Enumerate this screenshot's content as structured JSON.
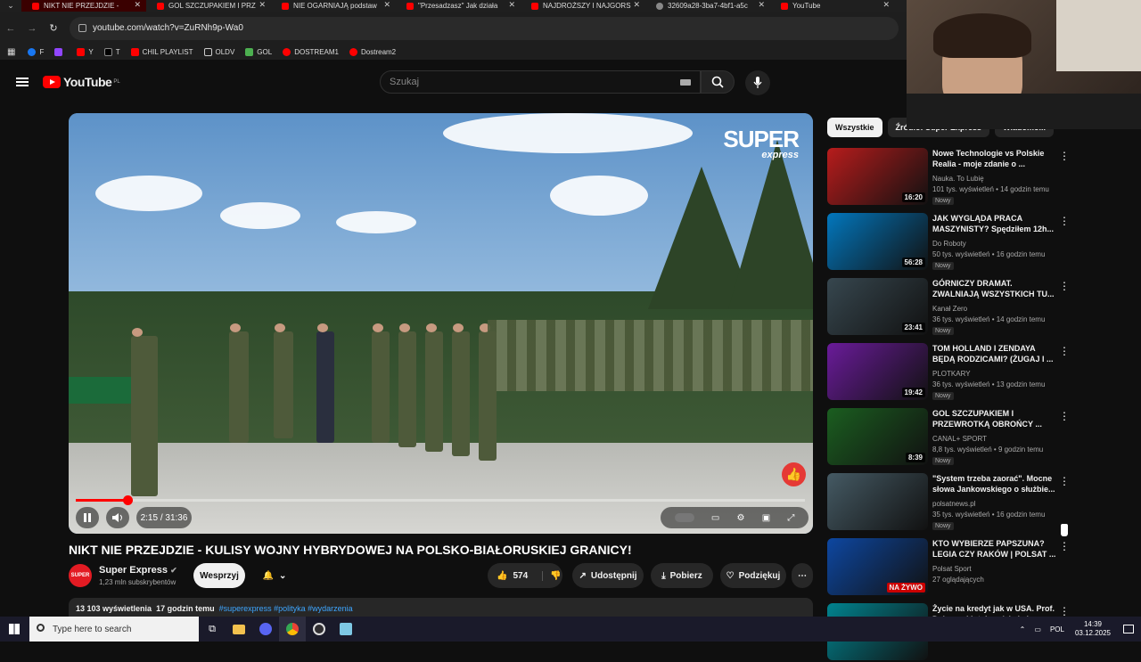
{
  "browser": {
    "tabs": [
      {
        "label": "NIKT NIE PRZEJDZIE -",
        "active": true
      },
      {
        "label": "GOL SZCZUPAKIEM I PRZ"
      },
      {
        "label": "NIE OGARNIAJĄ podstaw"
      },
      {
        "label": "\"Przesadzasz\" Jak działa"
      },
      {
        "label": "NAJDROŻSZY I NAJGORS"
      },
      {
        "label": "32609a28-3ba7-4bf1-a5c"
      },
      {
        "label": "YouTube"
      }
    ],
    "url": "youtube.com/watch?v=ZuRNh9p-Wa0",
    "bookmarks": [
      "F",
      "Y",
      "T",
      "CHIL PLAYLIST",
      "OLDV",
      "GOL",
      "DOSTREAM1",
      "Dostream2"
    ]
  },
  "header": {
    "logo": "YouTube",
    "region": "PL",
    "search_placeholder": "Szukaj"
  },
  "player": {
    "brand_line1": "SUPER",
    "brand_line2": "express",
    "time": "2:15 / 31:36",
    "progress": 0.071
  },
  "video": {
    "title": "NIKT NIE PRZEJDZIE - KULISY WOJNY HYBRYDOWEJ NA POLSKO-BIAŁORUSKIEJ GRANICY!",
    "channel": "Super Express",
    "channel_avatar": "SUPER",
    "subscribers": "1,23 mln subskrybentów",
    "support": "Wesprzyj",
    "likes": "574",
    "share": "Udostępnij",
    "download": "Pobierz",
    "thanks": "Podziękuj",
    "views": "13 103 wyświetlenia",
    "age": "17 godzin temu",
    "tags": "#superexpress #polityka #wydarzenia"
  },
  "chips": [
    "Wszystkie",
    "Źródło: Super Express",
    "Wiadomo..."
  ],
  "recommendations": [
    {
      "title": "Nowe Technologie vs Polskie Realia - moje zdanie o ...",
      "channel": "Nauka. To Lubię",
      "meta": "101 tys. wyświetleń • 14 godzin temu",
      "badge": "Nowy",
      "duration": "16:20",
      "color": "#b71c1c"
    },
    {
      "title": "JAK WYGLĄDA PRACA MASZYNISTY? Spędziłem 12h...",
      "channel": "Do Roboty",
      "meta": "50 tys. wyświetleń • 16 godzin temu",
      "badge": "Nowy",
      "duration": "56:28",
      "color": "#0277bd"
    },
    {
      "title": "GÓRNICZY DRAMAT. ZWALNIAJĄ WSZYSTKICH TU...",
      "channel": "Kanał Zero",
      "meta": "36 tys. wyświetleń • 14 godzin temu",
      "badge": "Nowy",
      "duration": "23:41",
      "color": "#37474f"
    },
    {
      "title": "TOM HOLLAND I ZENDAYA BĘDĄ RODZICAMI? (ŻUGAJ I ...",
      "channel": "PLOTKARY",
      "meta": "36 tys. wyświetleń • 13 godzin temu",
      "badge": "Nowy",
      "duration": "19:42",
      "color": "#6a1b9a"
    },
    {
      "title": "GOL SZCZUPAKIEM I PRZEWROTKĄ OBROŃCY ...",
      "channel": "CANAL+ SPORT",
      "meta": "8,8 tys. wyświetleń • 9 godzin temu",
      "badge": "Nowy",
      "duration": "8:39",
      "color": "#1b5e20"
    },
    {
      "title": "\"System trzeba zaorać\". Mocne słowa Jankowskiego o służbie...",
      "channel": "polsatnews.pl",
      "meta": "35 tys. wyświetleń • 16 godzin temu",
      "badge": "Nowy",
      "duration": "",
      "color": "#455a64"
    },
    {
      "title": "KTO WYBIERZE PAPSZUNA? LEGIA CZY RAKÓW | POLSAT ...",
      "channel": "Polsat Sport",
      "meta": "27 oglądających",
      "badge": "",
      "duration": "",
      "color": "#0d47a1"
    },
    {
      "title": "Życie na kredyt jak w USA. Prof. Dąbrowski: tak rodzi się kryzys",
      "channel": "",
      "meta": "",
      "badge": "",
      "duration": "",
      "color": "#00838f"
    }
  ],
  "live_label": "NA ŻYWO",
  "taskbar": {
    "search": "Type here to search",
    "lang": "POL",
    "time": "14:39",
    "date": "03.12.2025"
  }
}
